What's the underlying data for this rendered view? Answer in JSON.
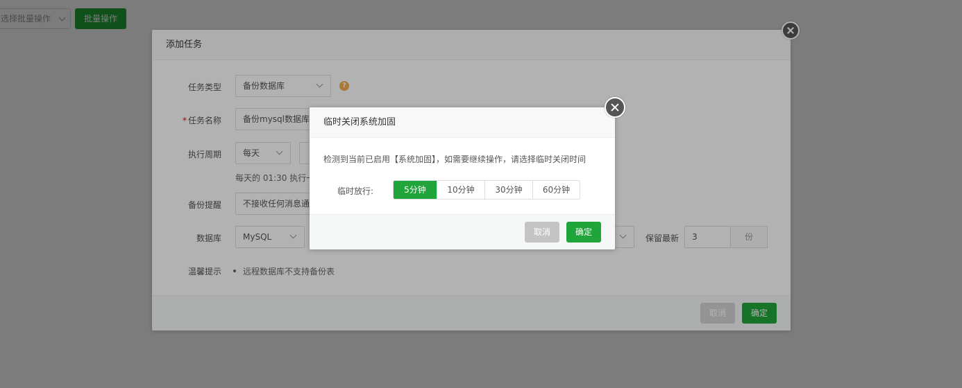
{
  "toolbar": {
    "batch_select_placeholder": "选择批量操作",
    "batch_button": "批量操作"
  },
  "add_task": {
    "title": "添加任务",
    "task_type_label": "任务类型",
    "task_type_value": "备份数据库",
    "task_name_label": "任务名称",
    "task_name_required": "*",
    "task_name_value": "备份mysql数据库",
    "period_label": "执行周期",
    "period_value": "每天",
    "period_hint": "每天的 01:30 执行一",
    "notify_label": "备份提醒",
    "notify_value": "不接收任何消息通",
    "database_label": "数据库",
    "database_value": "MySQL",
    "keep_label": "保留最新",
    "keep_value": "3",
    "keep_unit": "份",
    "tips_label": "温馨提示",
    "tips_item": "远程数据库不支持备份表",
    "cancel": "取消",
    "confirm": "确定"
  },
  "temp_close": {
    "title": "临时关闭系统加固",
    "description": "检测到当前已启用【系统加固】，如需要继续操作，请选择临时关闭时间",
    "release_label": "临时放行:",
    "options": [
      "5分钟",
      "10分钟",
      "30分钟",
      "60分钟"
    ],
    "selected": "5分钟",
    "cancel": "取消",
    "confirm": "确定"
  },
  "colors": {
    "accent": "#20a53a",
    "cancel_gray": "#c4c4c4",
    "help_orange": "#f0ad4e"
  },
  "icons": {
    "close": "close-icon",
    "help": "help-icon",
    "dropdown": "chevron-down-icon"
  }
}
